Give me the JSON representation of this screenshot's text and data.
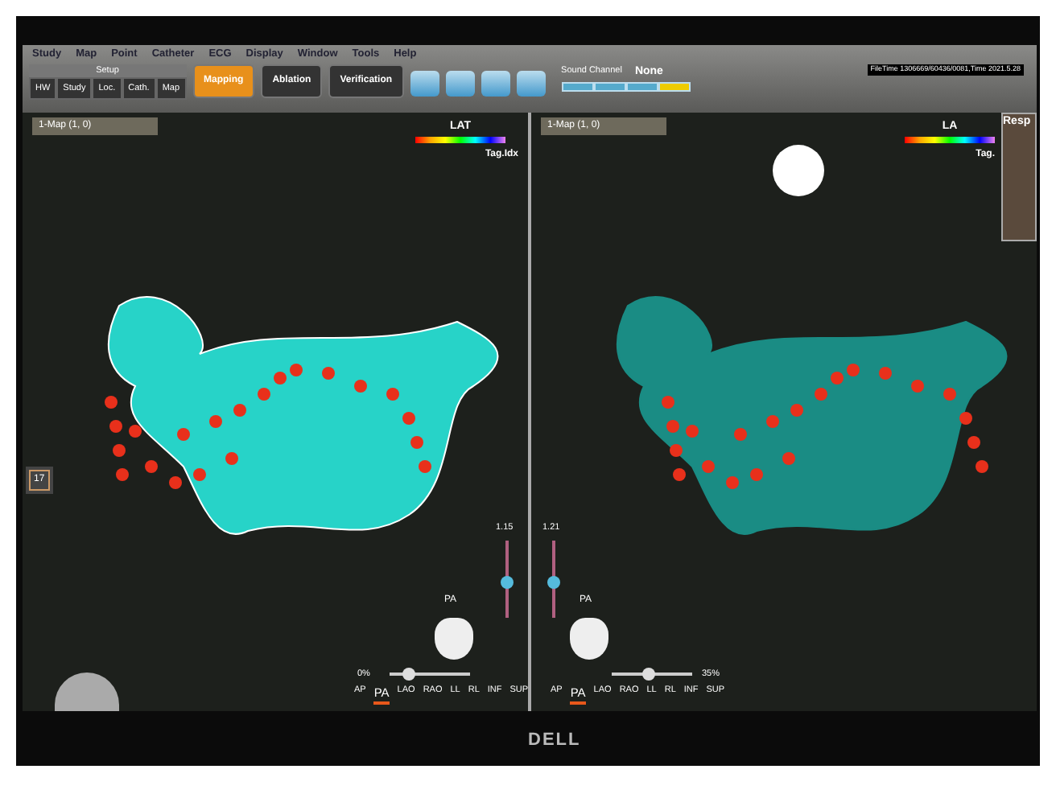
{
  "menu": [
    "Study",
    "Map",
    "Point",
    "Catheter",
    "ECG",
    "Display",
    "Window",
    "Tools",
    "Help"
  ],
  "setup": {
    "label": "Setup",
    "tabs": [
      "HW",
      "Study",
      "Loc.",
      "Cath.",
      "Map"
    ]
  },
  "modes": [
    {
      "label": "Mapping",
      "selected": true
    },
    {
      "label": "Ablation",
      "selected": false
    },
    {
      "label": "Verification",
      "selected": false
    }
  ],
  "sound_channel": {
    "label": "Sound Channel",
    "value": "None"
  },
  "file_time": "FileTime 1306669/60436/0081,Time 2021.5.28",
  "resp_panel": {
    "title": "Resp"
  },
  "left_tools": {
    "count": "17"
  },
  "panes": [
    {
      "map": "1-Map (1, 0)",
      "legend": "LAT",
      "tag": "Tag.Idx",
      "view": "PA",
      "zoom": {
        "value": "1.15",
        "level": 0.45
      },
      "opacity": {
        "value": "0%",
        "level": 0.2
      },
      "kind": "surface",
      "views": [
        {
          "label": "AP",
          "selected": false
        },
        {
          "label": "PA",
          "selected": true
        },
        {
          "label": "LAO",
          "selected": false
        },
        {
          "label": "RAO",
          "selected": false
        },
        {
          "label": "LL",
          "selected": false
        },
        {
          "label": "RL",
          "selected": false
        },
        {
          "label": "INF",
          "selected": false
        },
        {
          "label": "SUP",
          "selected": false
        }
      ]
    },
    {
      "map": "1-Map (1, 0)",
      "legend": "LA",
      "tag": "Tag.",
      "view": "PA",
      "zoom": {
        "value": "1.21",
        "level": 0.45
      },
      "opacity": {
        "value": "35%",
        "level": 0.45
      },
      "kind": "shaded",
      "views": [
        {
          "label": "AP",
          "selected": false
        },
        {
          "label": "PA",
          "selected": true
        },
        {
          "label": "LAO",
          "selected": false
        },
        {
          "label": "RAO",
          "selected": false
        },
        {
          "label": "LL",
          "selected": false
        },
        {
          "label": "RL",
          "selected": false
        },
        {
          "label": "INF",
          "selected": false
        },
        {
          "label": "SUP",
          "selected": false
        }
      ]
    }
  ],
  "monitor": {
    "brand": "DELL"
  }
}
